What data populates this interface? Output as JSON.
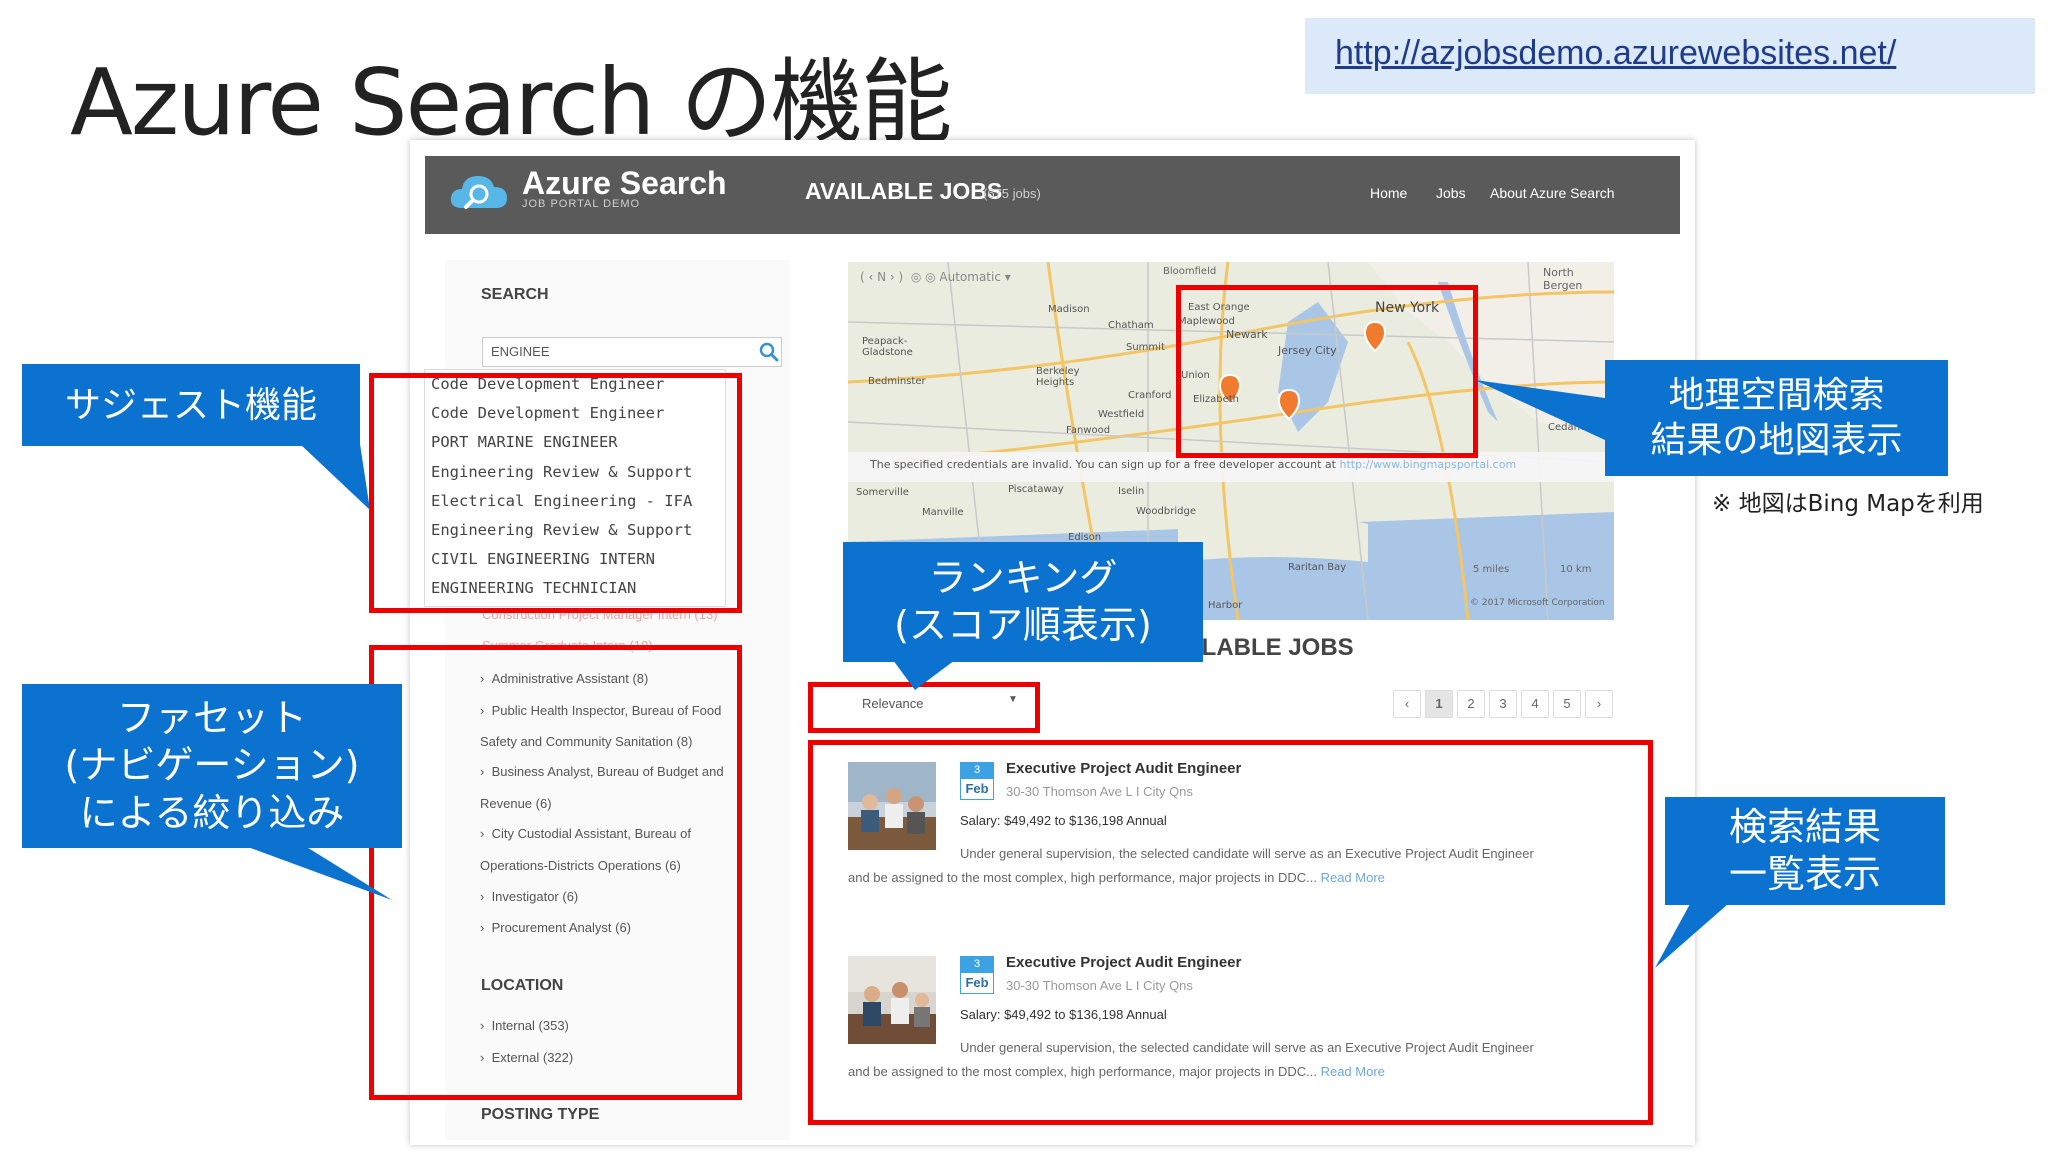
{
  "slide": {
    "title": "Azure Search の機能",
    "url": "http://azjobsdemo.azurewebsites.net/",
    "note": "※ 地図はBing Mapを利用"
  },
  "app": {
    "logo_text": "Azure Search",
    "logo_sub": "JOB PORTAL DEMO",
    "heading": "AVAILABLE JOBS",
    "job_count": "(675 jobs)",
    "nav": [
      "Home",
      "Jobs",
      "About Azure Search"
    ]
  },
  "sidebar": {
    "search_heading": "SEARCH",
    "search_value": "ENGINEE",
    "suggestions": [
      "Code Development Engineer",
      "Code Development Engineer",
      "PORT MARINE ENGINEER",
      "Engineering Review & Support",
      "Electrical Engineering - IFA",
      "Engineering Review & Support",
      "CIVIL ENGINEERING INTERN",
      "ENGINEERING TECHNICIAN"
    ],
    "hidden_facets": [
      "Construction Project Manager Intern (13)",
      "Summer Graduate Intern (10)"
    ],
    "facets": [
      "Administrative Assistant (8)",
      "Public Health Inspector, Bureau of Food",
      "Safety and Community Sanitation (8)",
      "Business Analyst, Bureau of Budget and",
      "Revenue (6)",
      "City Custodial Assistant, Bureau of",
      "Operations-Districts Operations (6)",
      "Investigator (6)",
      "Procurement Analyst (6)"
    ],
    "location_heading": "LOCATION",
    "locations": [
      "Internal (353)",
      "External (322)"
    ],
    "posting_heading": "POSTING TYPE"
  },
  "map": {
    "mode": "Automatic",
    "places": [
      "Bloomfield",
      "North Bergen",
      "Madison",
      "Chatham",
      "Maplewood",
      "East Orange",
      "Newark",
      "New York",
      "Peapack-Gladstone",
      "Summit",
      "Jersey City",
      "Berkeley Heights",
      "Bedminster",
      "Elizabeth",
      "Westfield",
      "Cranford",
      "Fanwood",
      "Somerville",
      "Manville",
      "Piscataway",
      "Iselin",
      "Woodbridge",
      "Edison",
      "Raritan Bay",
      "Cedarhurst",
      "Harbor",
      "Union"
    ],
    "credentials_msg": "The specified credentials are invalid. You can sign up for a free developer account at",
    "credentials_link": "http://www.bingmapsportal.com",
    "scale_1": "5 miles",
    "scale_2": "10 km",
    "copyright": "© 2017 Microsoft Corporation"
  },
  "results": {
    "heading": "ILABLE JOBS",
    "sort_value": "Relevance",
    "pages": [
      "‹",
      "1",
      "2",
      "3",
      "4",
      "5",
      "›"
    ],
    "jobs": [
      {
        "day": "3",
        "month": "Feb",
        "title": "Executive Project Audit Engineer",
        "address": "30-30 Thomson Ave L I City Qns",
        "salary": "Salary: $49,492 to $136,198 Annual",
        "desc1": "Under general supervision, the selected candidate will serve as an Executive Project Audit Engineer",
        "desc2": "and be assigned to the most complex, high performance, major projects in DDC...",
        "read_more": "Read More"
      },
      {
        "day": "3",
        "month": "Feb",
        "title": "Executive Project Audit Engineer",
        "address": "30-30 Thomson Ave L I City Qns",
        "salary": "Salary: $49,492 to $136,198 Annual",
        "desc1": "Under general supervision, the selected candidate will serve as an Executive Project Audit Engineer",
        "desc2": "and be assigned to the most complex, high performance, major projects in DDC...",
        "read_more": "Read More"
      }
    ]
  },
  "callouts": {
    "suggest": "サジェスト機能",
    "facet_1": "ファセット",
    "facet_2": "(ナビゲーション)",
    "facet_3": "による絞り込み",
    "geo_1": "地理空間検索",
    "geo_2": "結果の地図表示",
    "rank_1": "ランキング",
    "rank_2": "(スコア順表示)",
    "results_1": "検索結果",
    "results_2": "一覧表示"
  },
  "colors": {
    "callout": "#0b72d0",
    "annotation_border": "#ee0000",
    "navbar": "#5a5a5a",
    "url_bg": "#dce9f9"
  }
}
